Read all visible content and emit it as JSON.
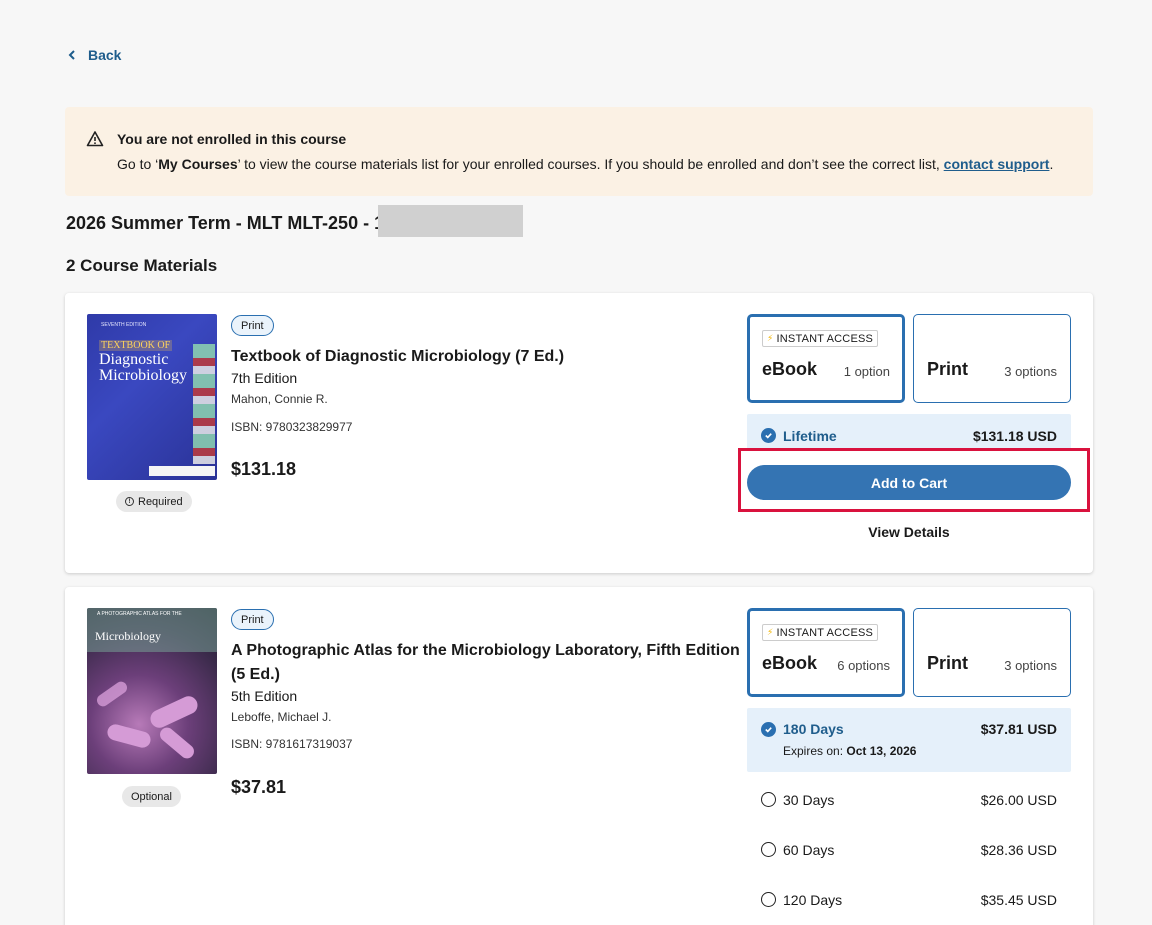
{
  "nav": {
    "back_label": "Back"
  },
  "alert": {
    "title": "You are not enrolled in this course",
    "msg_prefix": "Go to ‘",
    "msg_link_bold": "My Courses",
    "msg_middle": "’ to view the course materials list for your enrolled courses. If you should be enrolled and don’t see the correct list, ",
    "support_link": "contact support",
    "msg_suffix": "."
  },
  "course": {
    "title": "2026 Summer Term - MLT MLT-250 - 1",
    "materials_count": "2 Course Materials"
  },
  "books": [
    {
      "format_tag": "Print",
      "title": "Textbook of Diagnostic Microbiology (7 Ed.)",
      "edition": "7th Edition",
      "author": "Mahon, Connie R.",
      "isbn": "ISBN: 9780323829977",
      "price": "$131.18",
      "requirement": "Required",
      "cover": {
        "edition_text": "SEVENTH EDITION",
        "title_line1": "TEXTBOOK OF",
        "title_line2": "Diagnostic Microbiology"
      },
      "formats": [
        {
          "badge": "INSTANT ACCESS",
          "name": "eBook",
          "options": "1 option",
          "selected": true
        },
        {
          "name": "Print",
          "options": "3 options",
          "selected": false
        }
      ],
      "selected_option": {
        "name": "Lifetime",
        "price": "$131.18 USD"
      },
      "add_to_cart": "Add to Cart",
      "view_details": "View Details"
    },
    {
      "format_tag": "Print",
      "title": "A Photographic Atlas for the Microbiology Laboratory, Fifth Edition (5 Ed.)",
      "edition": "5th Edition",
      "author": "Leboffe, Michael J.",
      "isbn": "ISBN: 9781617319037",
      "price": "$37.81",
      "requirement": "Optional",
      "cover": {
        "title_line1": "A PHOTOGRAPHIC ATLAS FOR THE",
        "title_line2": "Microbiology"
      },
      "formats": [
        {
          "badge": "INSTANT ACCESS",
          "name": "eBook",
          "options": "6 options",
          "selected": true
        },
        {
          "name": "Print",
          "options": "3 options",
          "selected": false
        }
      ],
      "selected_option": {
        "name": "180 Days",
        "price": "$37.81 USD",
        "expires_label": "Expires on: ",
        "expires_date": "Oct 13, 2026"
      },
      "other_options": [
        {
          "name": "30 Days",
          "price": "$26.00 USD"
        },
        {
          "name": "60 Days",
          "price": "$28.36 USD"
        },
        {
          "name": "120 Days",
          "price": "$35.45 USD"
        }
      ]
    }
  ],
  "colors": {
    "accent": "#2a6fb0",
    "button": "#3474b3",
    "highlight": "#d9123e",
    "alert_bg": "#fbf1e4"
  }
}
